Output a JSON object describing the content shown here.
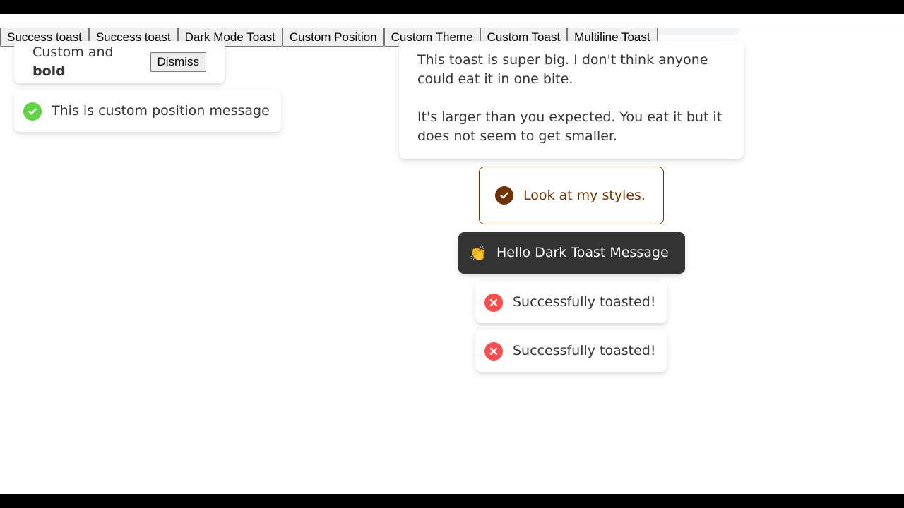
{
  "buttons": [
    {
      "label": "Success toast"
    },
    {
      "label": "Success toast"
    },
    {
      "label": "Dark Mode Toast"
    },
    {
      "label": "Custom Position"
    },
    {
      "label": "Custom Theme"
    },
    {
      "label": "Custom Toast"
    },
    {
      "label": "Multiline Toast"
    }
  ],
  "toasts": {
    "custom": {
      "text": "Custom and ",
      "bold": "bold",
      "dismiss_label": "Dismiss"
    },
    "position": {
      "message": "This is custom position message",
      "icon": "checkmark-icon",
      "color": "#61d345"
    },
    "multiline": {
      "paragraph1": "This toast is super big. I don't think anyone could eat it in one bite.",
      "paragraph2": "It's larger than you expected. You eat it but it does not seem to get smaller."
    },
    "theme": {
      "message": "Look at my styles.",
      "color": "#713200",
      "icon": "checkmark-icon"
    },
    "dark": {
      "message": "Hello Dark Toast Message",
      "emoji": "👏",
      "background": "#333333"
    },
    "errors": [
      {
        "message": "Successfully toasted!",
        "icon": "error-icon",
        "color": "#ff4b4b"
      },
      {
        "message": "Successfully toasted!",
        "icon": "error-icon",
        "color": "#ff4b4b"
      }
    ]
  }
}
